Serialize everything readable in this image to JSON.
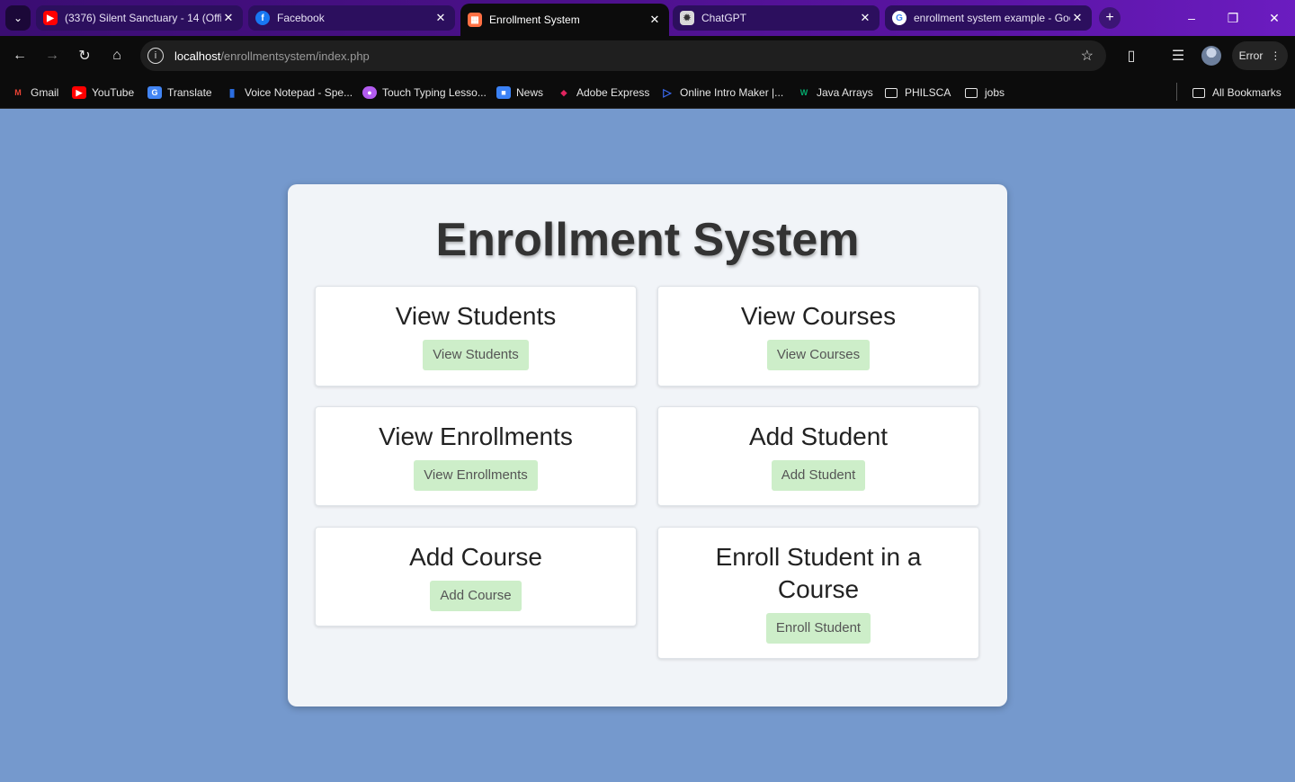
{
  "browser": {
    "tabs": [
      {
        "title": "(3376) Silent Sanctuary - 14 (Official",
        "icon": "youtube-icon",
        "color": "#ff0000",
        "active": false
      },
      {
        "title": "Facebook",
        "icon": "facebook-icon",
        "color": "#1877f2",
        "active": false
      },
      {
        "title": "Enrollment System",
        "icon": "page-icon",
        "color": "#ff7043",
        "active": true
      },
      {
        "title": "ChatGPT",
        "icon": "chatgpt-icon",
        "color": "#888888",
        "active": false
      },
      {
        "title": "enrollment system example - Google",
        "icon": "google-icon",
        "color": "#4285f4",
        "active": false
      }
    ],
    "url_host": "localhost",
    "url_path": "/enrollmentsystem/index.php",
    "profile_label": "Error",
    "bookmarks": [
      {
        "label": "Gmail",
        "icon": "gmail-icon",
        "color": "#ea4335"
      },
      {
        "label": "YouTube",
        "icon": "youtube-icon",
        "color": "#ff0000"
      },
      {
        "label": "Translate",
        "icon": "translate-icon",
        "color": "#4285f4"
      },
      {
        "label": "Voice Notepad - Spe...",
        "icon": "microphone-icon",
        "color": "#2b6de0"
      },
      {
        "label": "Touch Typing Lesso...",
        "icon": "typing-icon",
        "color": "#b35cf0"
      },
      {
        "label": "News",
        "icon": "news-icon",
        "color": "#3b82f6"
      },
      {
        "label": "Adobe Express",
        "icon": "adobe-express-icon",
        "color": "#e0245e"
      },
      {
        "label": "Online Intro Maker |...",
        "icon": "play-icon",
        "color": "#3b6cf5"
      },
      {
        "label": "Java Arrays",
        "icon": "w3schools-icon",
        "color": "#04aa6d"
      },
      {
        "label": "PHILSCA",
        "icon": "folder-icon",
        "color": "#e6e6e6"
      },
      {
        "label": "jobs",
        "icon": "folder-icon",
        "color": "#e6e6e6"
      }
    ],
    "all_bookmarks": "All Bookmarks"
  },
  "page": {
    "title": "Enrollment System",
    "cards": [
      {
        "heading": "View Students",
        "button": "View Students"
      },
      {
        "heading": "View Courses",
        "button": "View Courses"
      },
      {
        "heading": "View Enrollments",
        "button": "View Enrollments"
      },
      {
        "heading": "Add Student",
        "button": "Add Student"
      },
      {
        "heading": "Add Course",
        "button": "Add Course"
      },
      {
        "heading": "Enroll Student in a Course",
        "button": "Enroll Student"
      }
    ],
    "colors": {
      "background": "#7599cd",
      "button": "#cdeec9",
      "panel": "#f1f4f8"
    }
  }
}
